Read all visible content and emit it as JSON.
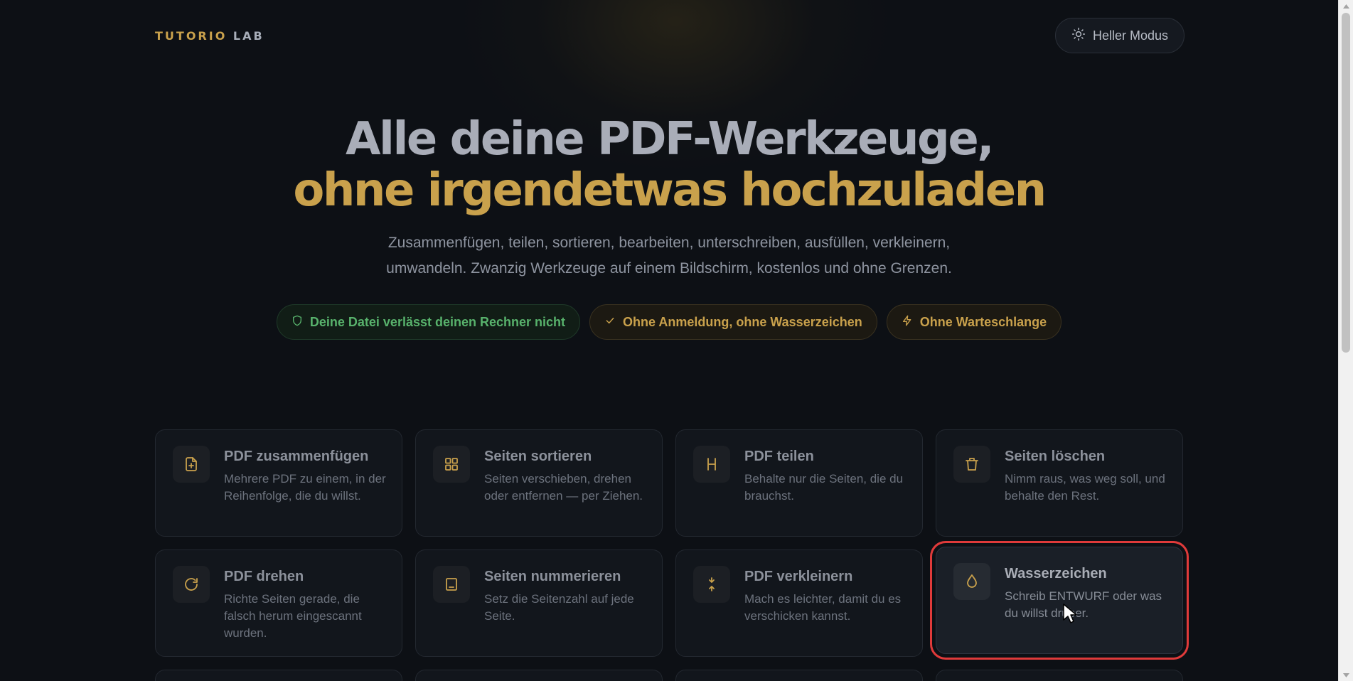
{
  "header": {
    "logo_part1": "TUTORIO",
    "logo_part2": "LAB",
    "mode_button": "Heller Modus"
  },
  "hero": {
    "title_line1": "Alle deine PDF-Werkzeuge,",
    "title_line2": "ohne irgendetwas hochzuladen",
    "subtitle": "Zusammenfügen, teilen, sortieren, bearbeiten, unterschreiben, ausfüllen, verkleinern, umwandeln. Zwanzig Werkzeuge auf einem Bildschirm, kostenlos und ohne Grenzen."
  },
  "badges": [
    {
      "label": "Deine Datei verlässt deinen Rechner nicht",
      "icon": "shield-icon"
    },
    {
      "label": "Ohne Anmeldung, ohne Wasserzeichen",
      "icon": "check-icon"
    },
    {
      "label": "Ohne Warteschlange",
      "icon": "lightning-icon"
    }
  ],
  "tools": [
    {
      "title": "PDF zusammenfügen",
      "desc": "Mehrere PDF zu einem, in der Reihenfolge, die du willst.",
      "icon": "merge-icon"
    },
    {
      "title": "Seiten sortieren",
      "desc": "Seiten verschieben, drehen oder entfernen — per Ziehen.",
      "icon": "grid-icon"
    },
    {
      "title": "PDF teilen",
      "desc": "Behalte nur die Seiten, die du brauchst.",
      "icon": "split-icon"
    },
    {
      "title": "Seiten löschen",
      "desc": "Nimm raus, was weg soll, und behalte den Rest.",
      "icon": "trash-icon"
    },
    {
      "title": "PDF drehen",
      "desc": "Richte Seiten gerade, die falsch herum eingescannt wurden.",
      "icon": "rotate-icon"
    },
    {
      "title": "Seiten nummerieren",
      "desc": "Setz die Seitenzahl auf jede Seite.",
      "icon": "page-number-icon"
    },
    {
      "title": "PDF verkleinern",
      "desc": "Mach es leichter, damit du es verschicken kannst.",
      "icon": "compress-icon"
    },
    {
      "title": "Wasserzeichen",
      "desc": "Schreib ENTWURF oder was du willst drüber.",
      "icon": "droplet-icon"
    }
  ],
  "colors": {
    "accent_gold": "#c9a14c",
    "privacy_green": "#58b26c",
    "background": "#0d1015",
    "highlight_outline": "#e03a3a"
  }
}
